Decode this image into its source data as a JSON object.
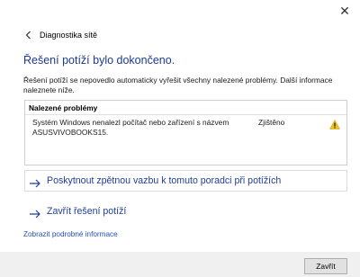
{
  "window": {
    "close_glyph": "✕",
    "title": "Diagnostika sítě"
  },
  "main": {
    "heading": "Řešení potíží bylo dokončeno.",
    "intro": "Řešení potíží se nepovedlo automaticky vyřešit všechny nalezené problémy. Další informace naleznete níže."
  },
  "problems": {
    "header": "Nalezené problémy",
    "items": [
      {
        "description": "Systém Windows nenalezl počítač nebo zařízení s názvem ASUSVIVOBOOKS15.",
        "status": "Zjištěno",
        "icon": "warning-icon"
      }
    ]
  },
  "links": {
    "feedback": "Poskytnout zpětnou vazbu k tomuto poradci při potížích",
    "close_troubleshooter": "Zavřít řešení potíží",
    "details": "Zobrazit podrobné informace"
  },
  "footer": {
    "close_button": "Zavřít"
  },
  "colors": {
    "heading": "#1a3a8f",
    "link": "#1f3f96",
    "warning": "#f0c419",
    "footer_bg": "#f0f0f0"
  }
}
